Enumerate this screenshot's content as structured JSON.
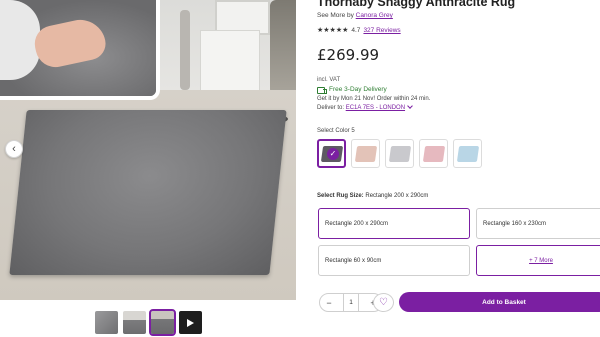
{
  "product": {
    "title": "Thornaby Shaggy Anthracite Rug",
    "see_more_prefix": "See More by",
    "brand": "Canora Grey",
    "rating_value": "4.7",
    "reviews": "327 Reviews",
    "stars": "★★★★★",
    "price": "£269.99",
    "vat": "incl. VAT",
    "delivery": "Free 3-Day Delivery",
    "get_it": "Get it by Mon 21 Nov! Order within 24 min.",
    "deliver_to_label": "Deliver to:",
    "deliver_to_value": "EC1A 7ES - LONDON"
  },
  "gallery": {
    "prev_icon": "‹",
    "thumbnails": [
      {
        "name": "close-up"
      },
      {
        "name": "room-view"
      },
      {
        "name": "room-view-selected",
        "selected": true
      },
      {
        "name": "video"
      }
    ]
  },
  "colors": {
    "label": "Select Color 5",
    "swatches": [
      {
        "color": "#5e5a63",
        "selected": true
      },
      {
        "color": "#e3c3b8"
      },
      {
        "color": "#c9c9cd"
      },
      {
        "color": "#e6b9bf"
      },
      {
        "color": "#b9d6e6"
      }
    ],
    "check": "✓"
  },
  "sizes": {
    "label_prefix": "Select Rug Size:",
    "label_value": "Rectangle 200 x 290cm",
    "options": [
      {
        "label": "Rectangle 200 x 290cm",
        "selected": true
      },
      {
        "label": "Rectangle 160 x 230cm"
      },
      {
        "label": "Rectangle 60 x 90cm"
      },
      {
        "label": "+ 7 More",
        "more": true
      }
    ]
  },
  "purchase": {
    "minus": "−",
    "quantity": "1",
    "plus": "+",
    "heart": "♡",
    "add_to_basket": "Add to Basket"
  },
  "theme": {
    "accent": "#7b1fa2",
    "delivery_green": "#2e7d32"
  }
}
